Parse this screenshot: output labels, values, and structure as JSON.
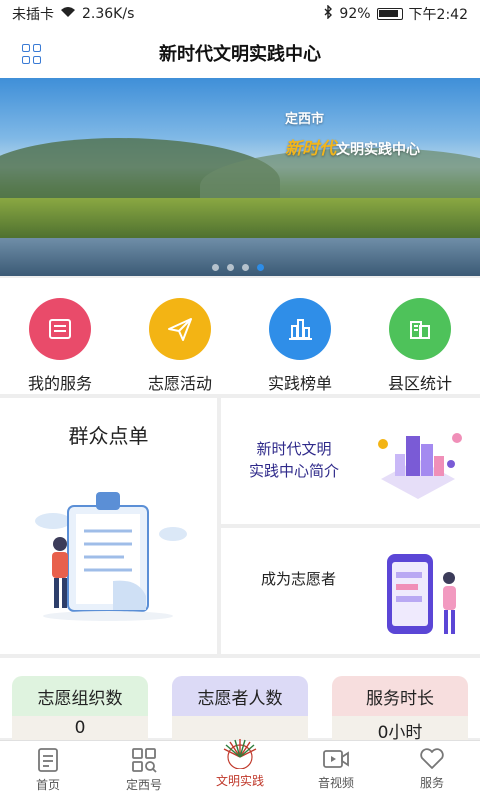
{
  "status_bar": {
    "sim": "未插卡",
    "speed": "2.36K/s",
    "battery": "92%",
    "time": "下午2:42"
  },
  "header": {
    "title": "新时代文明实践中心"
  },
  "banner": {
    "city": "定西市",
    "highlight": "新时代",
    "rest": "文明实践中心",
    "active_dot": 3
  },
  "quick": [
    {
      "label": "我的服务",
      "icon": "tray-icon",
      "color": "#e94b6a"
    },
    {
      "label": "志愿活动",
      "icon": "paper-plane-icon",
      "color": "#f3b414"
    },
    {
      "label": "实践榜单",
      "icon": "chart-bars-icon",
      "color": "#2f8ee8"
    },
    {
      "label": "县区统计",
      "icon": "building-stats-icon",
      "color": "#4ec25a"
    }
  ],
  "cards": {
    "left_title": "群众点单",
    "right_top_line1": "新时代文明",
    "right_top_line2": "实践中心简介",
    "right_bottom": "成为志愿者"
  },
  "stats": [
    {
      "label": "志愿组织数",
      "value": "0",
      "color": "#dff3df"
    },
    {
      "label": "志愿者人数",
      "value": "",
      "color": "#dcdaf6"
    },
    {
      "label": "服务时长",
      "value": "0小时",
      "color": "#f7dede"
    }
  ],
  "nav": [
    {
      "label": "首页",
      "icon": "document-icon",
      "active": false
    },
    {
      "label": "定西号",
      "icon": "grid-search-icon",
      "active": false
    },
    {
      "label": "文明实践",
      "icon": "sunburst-logo-icon",
      "active": true
    },
    {
      "label": "音视频",
      "icon": "video-icon",
      "active": false
    },
    {
      "label": "服务",
      "icon": "heart-icon",
      "active": false
    }
  ]
}
